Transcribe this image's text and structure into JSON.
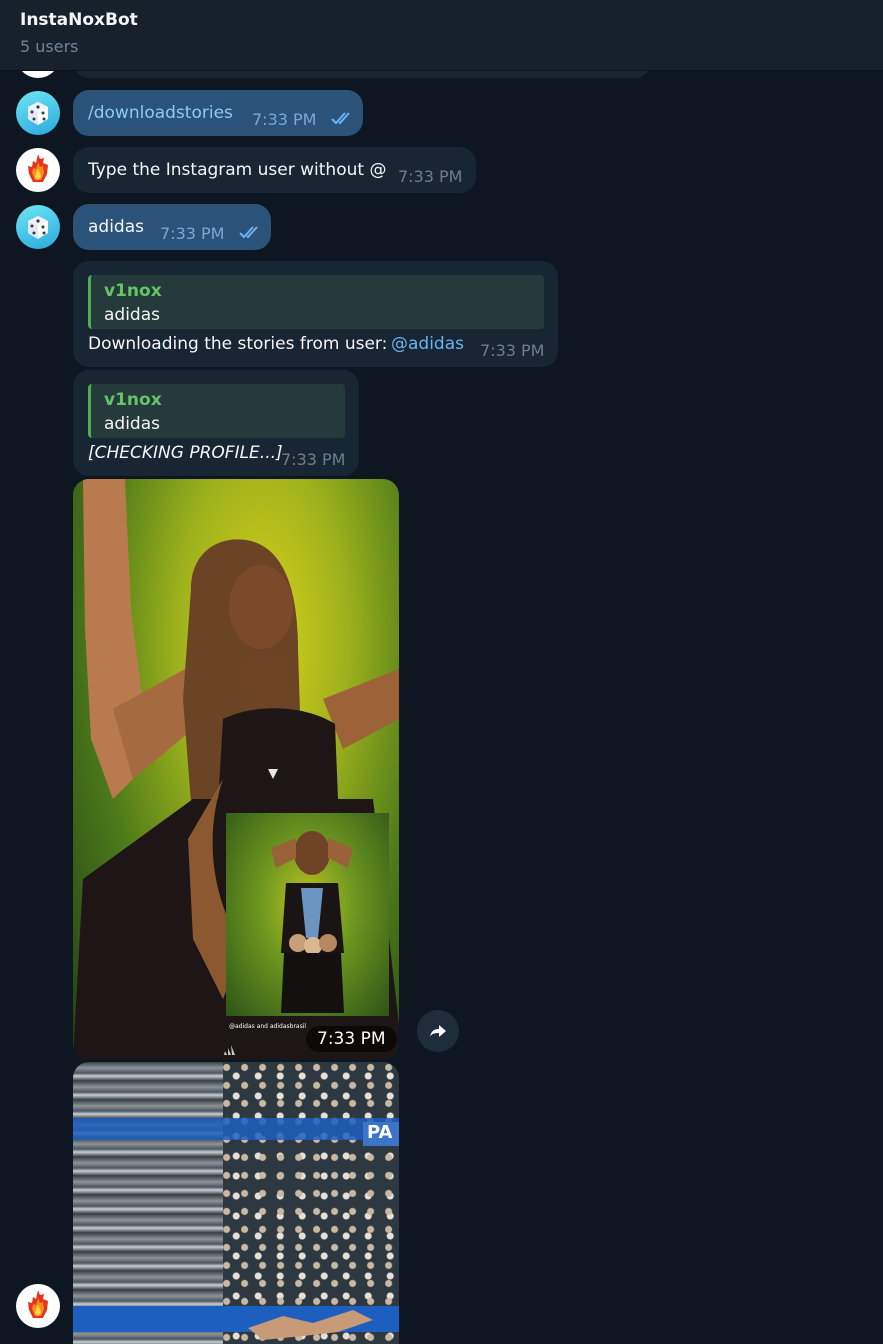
{
  "header": {
    "title": "InstaNoxBot",
    "subtitle": "5 users"
  },
  "messages": [
    {
      "text": "/downloadstories",
      "time": "7:33 PM"
    },
    {
      "text": "Type the Instagram user without @",
      "time": "7:33 PM"
    },
    {
      "text": "adidas",
      "time": "7:33 PM"
    },
    {
      "reply_name": "v1nox",
      "reply_text": "adidas",
      "text": "Downloading the stories from user:",
      "mention": "@adidas",
      "time": "7:33 PM"
    },
    {
      "reply_name": "v1nox",
      "reply_text": "adidas",
      "text": "[CHECKING PROFILE...]",
      "time": "7:33 PM"
    },
    {
      "photo_caption": "@adidas and adidasbrasil",
      "time": "7:33 PM"
    }
  ],
  "banner_text": "PA",
  "colors": {
    "background": "#0e1621",
    "header": "#17212b",
    "outgoing_bubble": "#2b5278",
    "incoming_bubble": "#182533",
    "reply_accent": "#4fae4e",
    "link": "#6ab3f3"
  },
  "icons": [
    "dice-avatar-icon",
    "fire-avatar-icon",
    "double-check-icon",
    "share-icon",
    "adidas-logo-icon"
  ]
}
